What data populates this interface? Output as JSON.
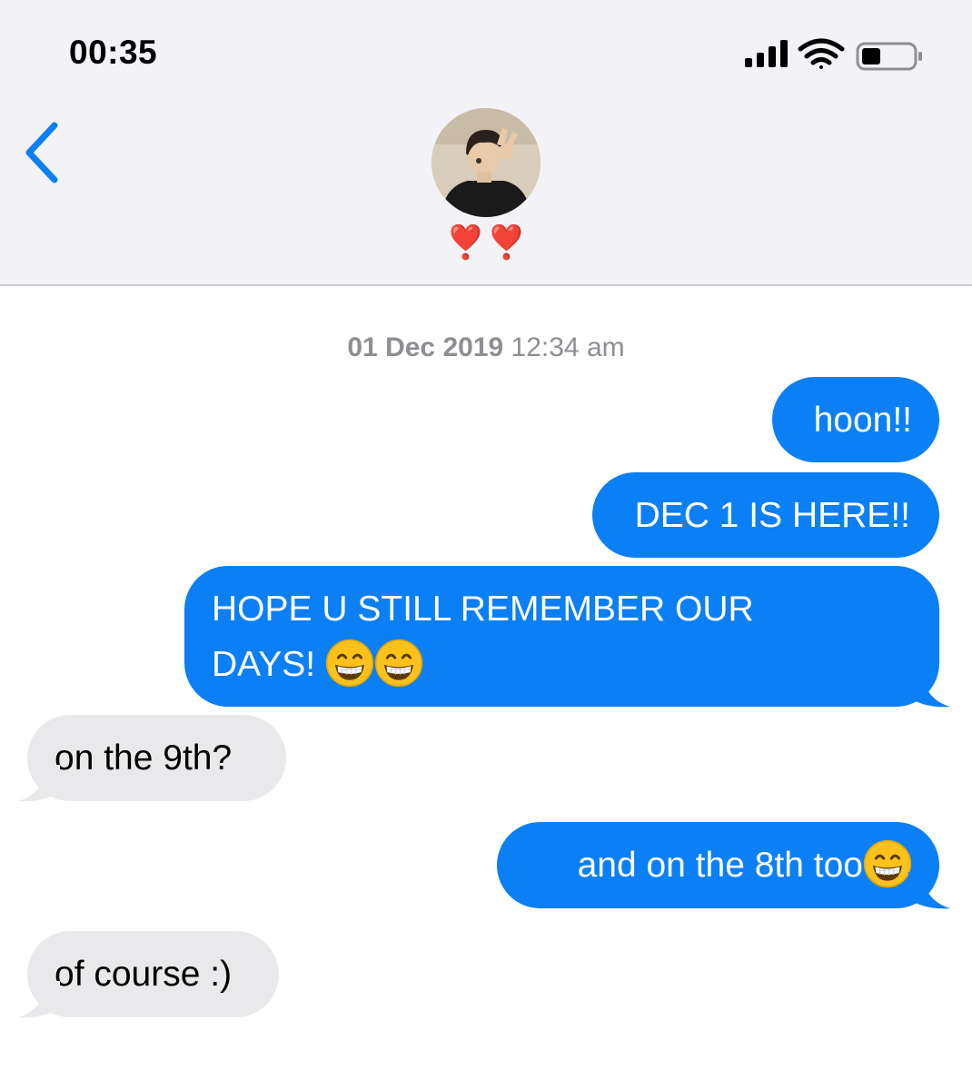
{
  "status_bar": {
    "time": "00:35",
    "icons": [
      "signal-bars-icon",
      "wifi-icon",
      "battery-icon"
    ]
  },
  "header": {
    "back_icon": "chevron-left-icon",
    "contact_name": "❣️❣️",
    "avatar": "contact-photo"
  },
  "thread": {
    "timestamp_date": "01 Dec 2019",
    "timestamp_time": "12:34 am",
    "messages": [
      {
        "from": "me",
        "text": "hoon!!"
      },
      {
        "from": "me",
        "text": "DEC 1 IS HERE!!"
      },
      {
        "from": "me",
        "line1": "HOPE U STILL REMEMBER OUR",
        "line2": "DAYS!",
        "emoji": "grinning-face-with-smiling-eyes x2"
      },
      {
        "from": "them",
        "text": "on the 9th?"
      },
      {
        "from": "me",
        "text": "and on the 8th too",
        "emoji": "grinning-face-with-smiling-eyes"
      },
      {
        "from": "them",
        "text": "of course :)"
      }
    ]
  },
  "colors": {
    "sent_bubble": "#0b7ff5",
    "received_bubble": "#e9e9eb",
    "header_bg": "#f2f2f7",
    "accent": "#0b7ff5",
    "timestamp": "#8e8e93"
  }
}
